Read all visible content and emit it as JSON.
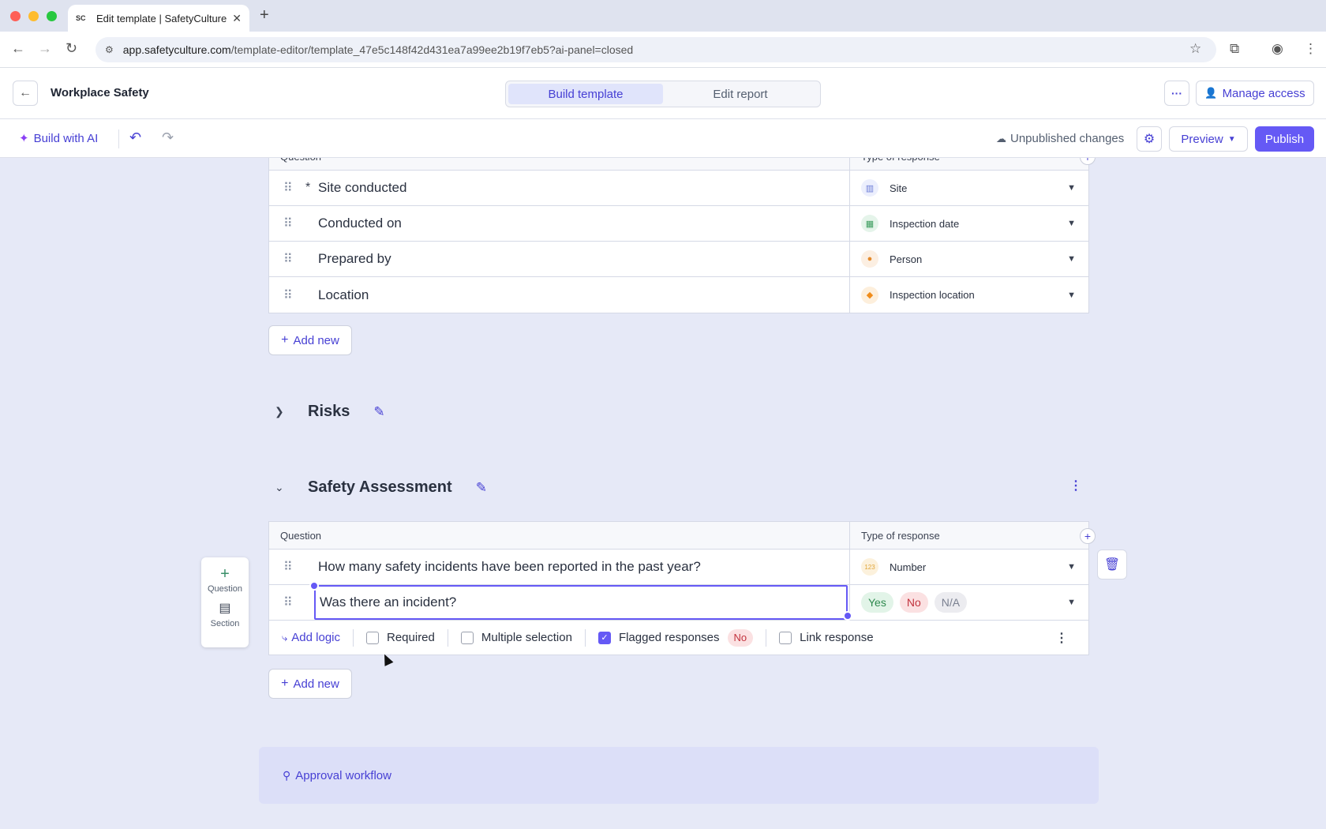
{
  "browser": {
    "tab_title": "Edit template | SafetyCulture",
    "tab_favicon": "SC",
    "url_host": "app.safetyculture.com",
    "url_path": "/template-editor/template_47e5c148f42d431ea7a99ee2b19f7eb5?ai-panel=closed"
  },
  "header": {
    "title": "Workplace Safety",
    "modes": [
      "Build template",
      "Edit report"
    ],
    "manage_access": "Manage access"
  },
  "toolbar": {
    "build_ai": "Build with AI",
    "status": "Unpublished changes",
    "preview": "Preview",
    "publish": "Publish"
  },
  "title_page_section": {
    "column_question": "Question",
    "column_response": "Type of response",
    "rows": [
      {
        "question": "Site conducted",
        "required": true,
        "response": "Site",
        "icon": "site-icon",
        "color": "#6b7bd6"
      },
      {
        "question": "Conducted on",
        "required": false,
        "response": "Inspection date",
        "icon": "calendar-icon",
        "color": "#3a9b5c"
      },
      {
        "question": "Prepared by",
        "required": false,
        "response": "Person",
        "icon": "person-icon",
        "color": "#e58a2a"
      },
      {
        "question": "Location",
        "required": false,
        "response": "Inspection location",
        "icon": "location-pin-icon",
        "color": "#f08c1a"
      }
    ],
    "add_new": "Add new"
  },
  "risks_section": {
    "title": "Risks"
  },
  "safety_section": {
    "title": "Safety Assessment",
    "column_question": "Question",
    "column_response": "Type of response",
    "rows": [
      {
        "question": "How many safety incidents have been reported in the past year?",
        "response": "Number",
        "icon": "number-icon",
        "color": "#e0a53a"
      },
      {
        "question": "Was there an incident?",
        "responses": [
          "Yes",
          "No",
          "N/A"
        ]
      }
    ],
    "options": {
      "add_logic": "Add logic",
      "required": "Required",
      "multiple_selection": "Multiple selection",
      "flagged_responses": "Flagged responses",
      "flagged_value": "No",
      "link_response": "Link response"
    },
    "add_new": "Add new"
  },
  "float_panel": {
    "question": "Question",
    "section": "Section"
  },
  "approval": {
    "label": "Approval workflow"
  },
  "colors": {
    "accent": "#4740d4",
    "primary_button": "#6559f5",
    "background": "#e6e9f7"
  }
}
